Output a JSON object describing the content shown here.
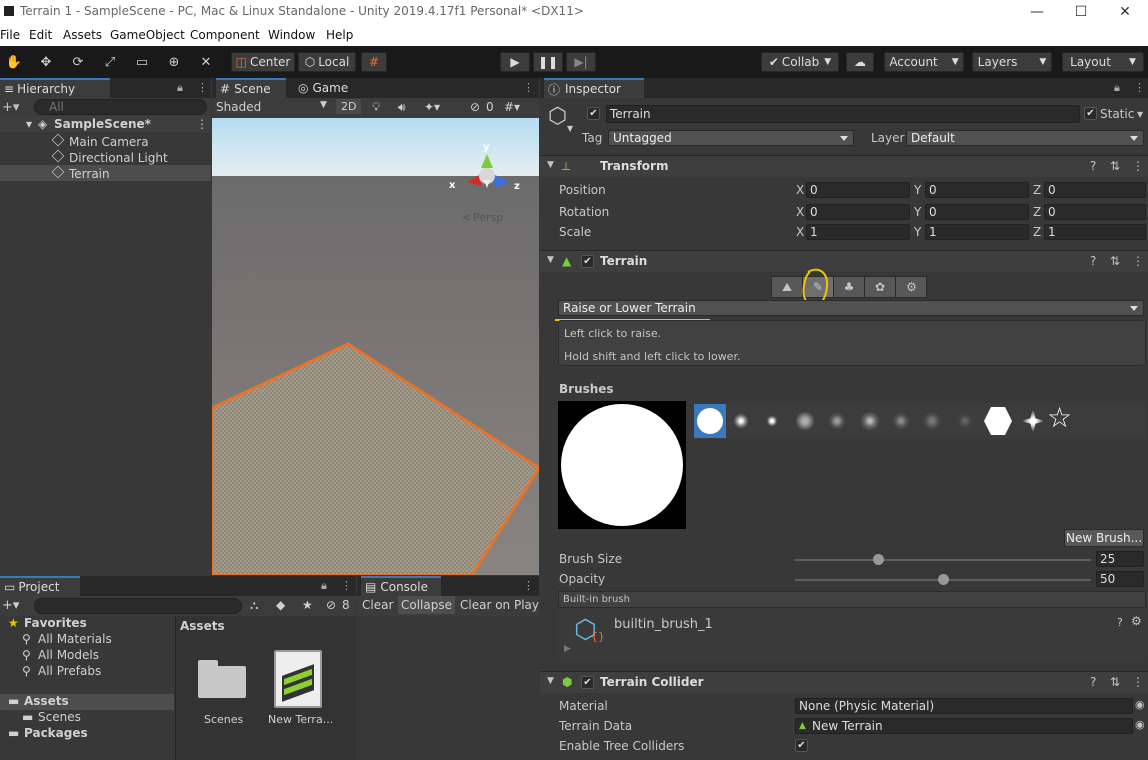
{
  "window": {
    "title": "Terrain 1 - SampleScene - PC, Mac & Linux Standalone - Unity 2019.4.17f1 Personal* <DX11>",
    "minimize": "—",
    "maximize": "☐",
    "close": "✕"
  },
  "menu": [
    "File",
    "Edit",
    "Assets",
    "GameObject",
    "Component",
    "Window",
    "Help"
  ],
  "toolbar": {
    "pivot": "Center",
    "space": "Local",
    "collab": "Collab",
    "account": "Account",
    "layers": "Layers",
    "layout": "Layout"
  },
  "hierarchy": {
    "tab": "Hierarchy",
    "search_placeholder": "All",
    "scene": "SampleScene*",
    "items": [
      "Main Camera",
      "Directional Light",
      "Terrain"
    ]
  },
  "scene": {
    "tab_scene": "Scene",
    "tab_game": "Game",
    "shading": "Shaded",
    "mode2d": "2D",
    "hidden_count": "0",
    "persp": "Persp",
    "gizmo_x": "x",
    "gizmo_y": "y",
    "gizmo_z": "z"
  },
  "project": {
    "tab": "Project",
    "hidden_count": "8",
    "favorites": "Favorites",
    "fav_items": [
      "All Materials",
      "All Models",
      "All Prefabs"
    ],
    "assets": "Assets",
    "scenes": "Scenes",
    "packages": "Packages",
    "assets_header": "Assets",
    "asset_items": [
      "Scenes",
      "New Terra..."
    ]
  },
  "console": {
    "tab": "Console",
    "clear": "Clear",
    "collapse": "Collapse",
    "clear_on_play": "Clear on Play"
  },
  "inspector": {
    "tab": "Inspector",
    "object_name": "Terrain",
    "static": "Static",
    "tag_label": "Tag",
    "tag": "Untagged",
    "layer_label": "Layer",
    "layer": "Default",
    "transform": {
      "title": "Transform",
      "rows": [
        {
          "label": "Position",
          "x": "0",
          "y": "0",
          "z": "0"
        },
        {
          "label": "Rotation",
          "x": "0",
          "y": "0",
          "z": "0"
        },
        {
          "label": "Scale",
          "x": "1",
          "y": "1",
          "z": "1"
        }
      ],
      "axis_x": "X",
      "axis_y": "Y",
      "axis_z": "Z"
    },
    "terrain": {
      "title": "Terrain",
      "tool": "Raise or Lower Terrain",
      "help1": "Left click to raise.",
      "help2": "Hold shift and left click to lower.",
      "brushes_label": "Brushes",
      "new_brush": "New Brush...",
      "brush_size_label": "Brush Size",
      "brush_size": "25",
      "brush_size_fraction": 0.28,
      "opacity_label": "Opacity",
      "opacity": "50",
      "opacity_fraction": 0.5,
      "builtin_label": "Built-in brush",
      "brush_asset": "builtin_brush_1"
    },
    "collider": {
      "title": "Terrain Collider",
      "material_label": "Material",
      "material": "None (Physic Material)",
      "data_label": "Terrain Data",
      "data": "New Terrain",
      "trees_label": "Enable Tree Colliders"
    }
  },
  "colors": {
    "accent": "#3a79bb",
    "selection_outline": "#e8732a",
    "annotation": "#f2c200"
  }
}
